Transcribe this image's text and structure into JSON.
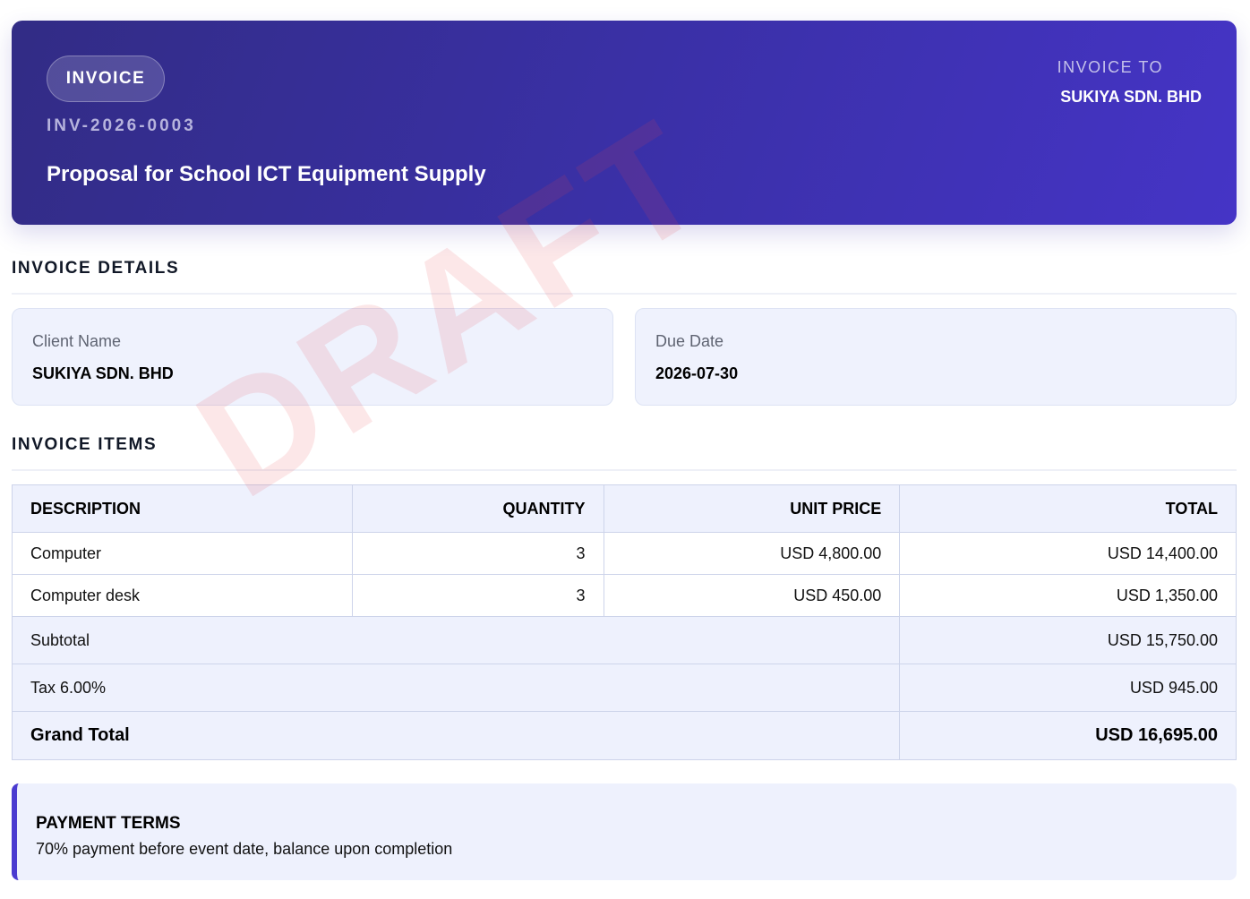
{
  "header": {
    "badge": "INVOICE",
    "invoice_number": "INV-2026-0003",
    "title": "Proposal for School ICT Equipment Supply",
    "invoice_to_label": "INVOICE TO",
    "invoice_to_name": "SUKIYA SDN. BHD"
  },
  "details": {
    "section_title": "INVOICE DETAILS",
    "client_label": "Client Name",
    "client_value": "SUKIYA SDN. BHD",
    "due_label": "Due Date",
    "due_value": "2026-07-30"
  },
  "items": {
    "section_title": "INVOICE ITEMS",
    "columns": [
      "DESCRIPTION",
      "QUANTITY",
      "UNIT PRICE",
      "TOTAL"
    ],
    "rows": [
      {
        "description": "Computer",
        "quantity": "3",
        "unit_price": "USD 4,800.00",
        "total": "USD 14,400.00"
      },
      {
        "description": "Computer desk",
        "quantity": "3",
        "unit_price": "USD 450.00",
        "total": "USD 1,350.00"
      }
    ],
    "subtotal_label": "Subtotal",
    "subtotal_value": "USD 15,750.00",
    "tax_label": "Tax 6.00%",
    "tax_value": "USD 945.00",
    "grand_total_label": "Grand Total",
    "grand_total_value": "USD 16,695.00"
  },
  "payment_terms": {
    "title": "PAYMENT TERMS",
    "text": "70% payment before event date, balance upon completion"
  },
  "watermark": "DRAFT",
  "colors": {
    "header_start": "#322c85",
    "header_end": "#4534c6",
    "accent": "#4a3bd0",
    "card_bg": "#eff2fd",
    "watermark": "#e84850"
  }
}
